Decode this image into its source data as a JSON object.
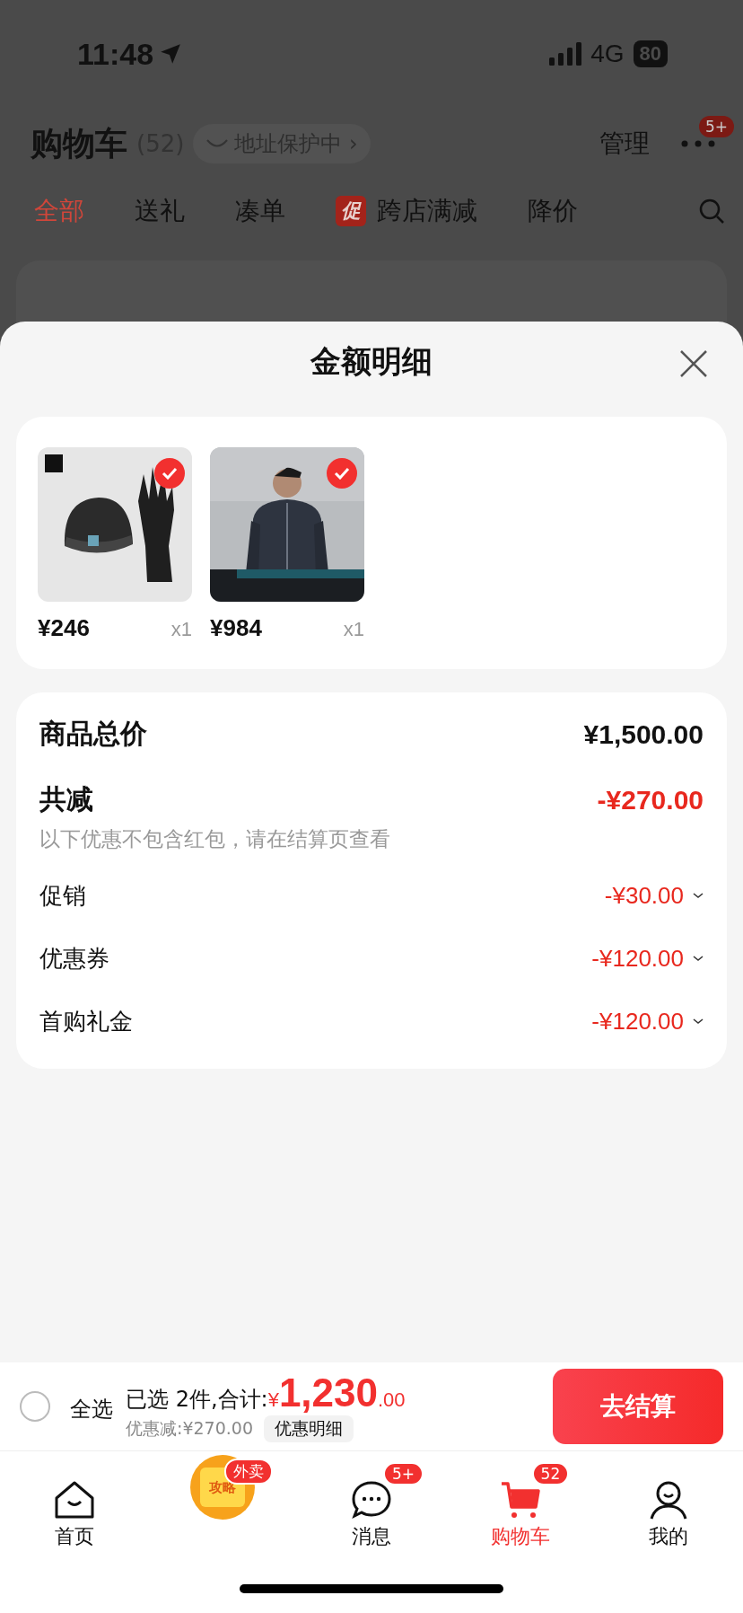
{
  "status_bar": {
    "time": "11:48",
    "network": "4G",
    "battery": "80"
  },
  "header": {
    "title": "购物车",
    "count": "(52)",
    "address_protection": "地址保护中",
    "chevron": "›",
    "manage": "管理",
    "more_badge": "5+"
  },
  "filter_tabs": [
    {
      "label": "全部",
      "selected": true
    },
    {
      "label": "送礼",
      "selected": false
    },
    {
      "label": "凑单",
      "selected": false
    },
    {
      "label": "跨店满减",
      "selected": false,
      "tag": "促"
    },
    {
      "label": "降价",
      "selected": false
    }
  ],
  "sheet": {
    "title": "金额明细",
    "products": [
      {
        "kind": "accessories",
        "price": "¥246",
        "qty": "x1",
        "checked": true
      },
      {
        "kind": "jacket",
        "price": "¥984",
        "qty": "x1",
        "checked": true
      }
    ],
    "summary": {
      "total_label": "商品总价",
      "total": "¥1,500.00",
      "discount_label": "共减",
      "discount": "-¥270.00",
      "note": "以下优惠不包含红包，请在结算页查看",
      "items": [
        {
          "label": "促销",
          "amount": "-¥30.00",
          "expanded": false
        },
        {
          "label": "优惠券",
          "amount": "-¥120.00",
          "expanded": false
        },
        {
          "label": "首购礼金",
          "amount": "-¥120.00",
          "expanded": false
        }
      ]
    }
  },
  "checkout_bar": {
    "select_all": {
      "label": "全选",
      "checked": false
    },
    "selected_text": "已选 2件,合计:",
    "currency": "¥",
    "amount_int": "1,230",
    "amount_dec": ".00",
    "saving": "优惠减:¥270.00",
    "detail_button": "优惠明细",
    "checkout_button": "去结算"
  },
  "tab_bar": [
    {
      "kind": "home",
      "label": "首页",
      "selected": false
    },
    {
      "kind": "promo",
      "badge": "外卖",
      "text": "攻略"
    },
    {
      "kind": "chat",
      "label": "消息",
      "badge": "5+",
      "selected": false
    },
    {
      "kind": "cart",
      "label": "购物车",
      "badge": "52",
      "selected": true
    },
    {
      "kind": "person",
      "label": "我的",
      "selected": false
    }
  ]
}
